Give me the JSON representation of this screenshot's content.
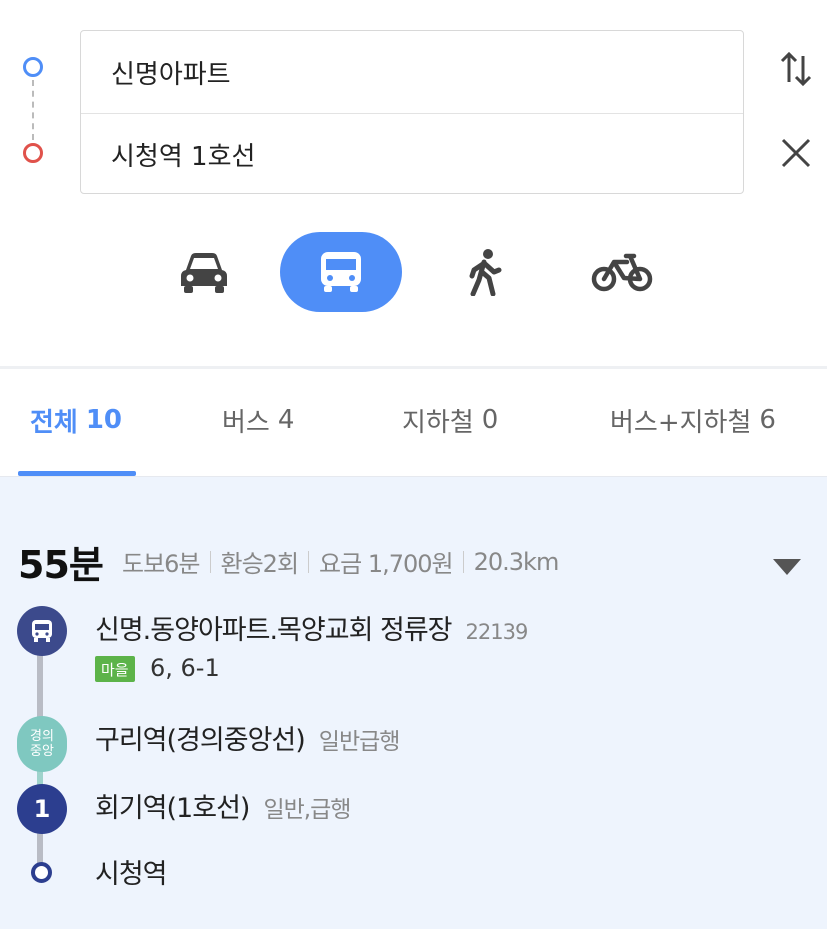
{
  "route": {
    "origin": "신명아파트",
    "destination": "시청역 1호선"
  },
  "modes": [
    {
      "name": "car",
      "icon": "car-icon",
      "active": false
    },
    {
      "name": "bus",
      "icon": "bus-icon",
      "active": true
    },
    {
      "name": "walk",
      "icon": "walk-icon",
      "active": false
    },
    {
      "name": "bike",
      "icon": "bike-icon",
      "active": false
    }
  ],
  "tabs": [
    {
      "label": "전체",
      "count": "10",
      "active": true
    },
    {
      "label": "버스",
      "count": "4",
      "active": false
    },
    {
      "label": "지하철",
      "count": "0",
      "active": false
    },
    {
      "label": "버스+지하철",
      "count": "6",
      "active": false
    }
  ],
  "result": {
    "total_time": "55분",
    "walk": "도보6분",
    "transfers": "환승2회",
    "fare": "요금 1,700원",
    "distance": "20.3km",
    "steps": [
      {
        "type": "bus-stop",
        "name": "신명.동양아파트.목양교회 정류장",
        "id": "22139",
        "badge": "마을",
        "routes": "6, 6-1"
      },
      {
        "type": "subway",
        "icon_text": "경의\n중앙",
        "name": "구리역(경의중앙선)",
        "sub": "일반급행"
      },
      {
        "type": "subway",
        "icon_text": "1",
        "name": "회기역(1호선)",
        "sub": "일반,급행"
      },
      {
        "type": "end",
        "name": "시청역"
      }
    ]
  },
  "colors": {
    "accent": "#4f8ef7",
    "origin_dot": "#4f8ef7",
    "destination_dot": "#e0524b",
    "bus_line": "#3c4a8c",
    "gyeongui_jungang_line": "#7fc8c0",
    "line1": "#2c3e8f",
    "maeul_badge": "#5cb349"
  }
}
